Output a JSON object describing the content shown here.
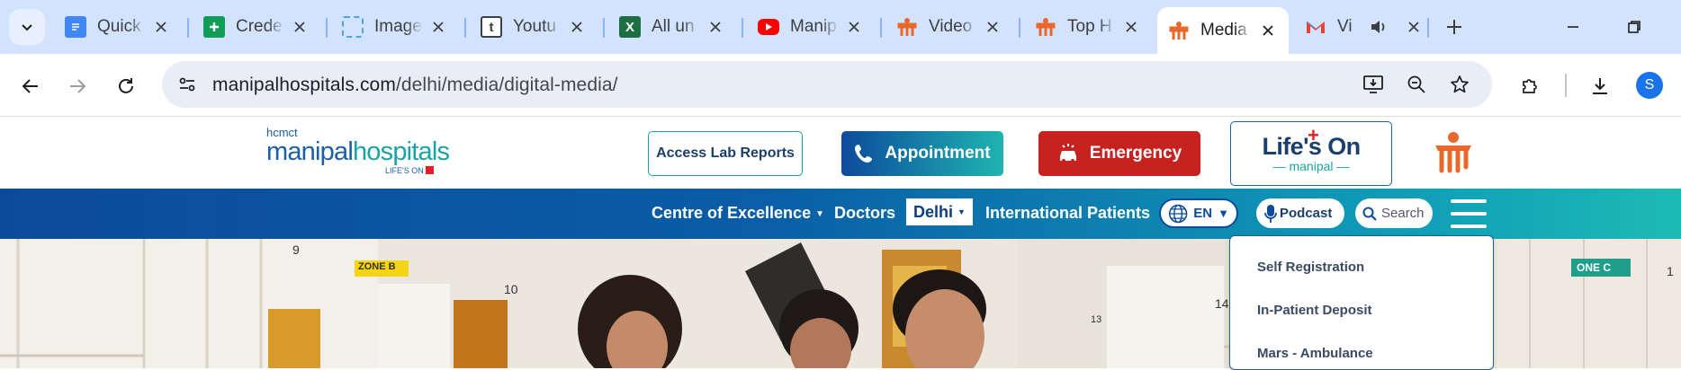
{
  "browser": {
    "tabs": [
      {
        "label": "Quick",
        "icon": "google-docs-icon",
        "color": "#4285f4"
      },
      {
        "label": "Crede",
        "icon": "google-sheets-icon",
        "color": "#0f9d58"
      },
      {
        "label": "Image",
        "icon": "image-icon",
        "color": "#4fa3e0"
      },
      {
        "label": "Youtu",
        "icon": "t-letter-icon",
        "color": "#3c4043"
      },
      {
        "label": "All un",
        "icon": "excel-icon",
        "color": "#1d6f42"
      },
      {
        "label": "Manip",
        "icon": "youtube-icon",
        "color": "#ff0000"
      },
      {
        "label": "Video",
        "icon": "manipal-icon",
        "color": "#e8672b"
      },
      {
        "label": "Top H",
        "icon": "manipal-icon",
        "color": "#e8672b"
      },
      {
        "label": "Media",
        "icon": "manipal-icon",
        "color": "#e8672b",
        "active": true
      },
      {
        "label": "Vi",
        "icon": "gmail-icon",
        "color": "#ea4335",
        "audio": true
      }
    ],
    "url_host": "manipalhospitals.com",
    "url_path": "/delhi/media/digital-media/",
    "profile_initial": "S"
  },
  "site": {
    "logo_small": "hcmct",
    "logo_main_a": "manipal",
    "logo_main_b": "hospitals",
    "logo_tag": "LIFE'S ON",
    "lab_reports": "Access Lab Reports",
    "appointment": "Appointment",
    "emergency": "Emergency",
    "lifes_on": "Life's On",
    "lifes_on_sub": "manipal",
    "nav": {
      "centre": "Centre of Excellence",
      "doctors": "Doctors",
      "city": "Delhi",
      "international": "International Patients",
      "lang": "EN",
      "podcast": "Podcast",
      "search": "Search"
    },
    "menu": [
      "Self Registration",
      "In-Patient Deposit",
      "Mars - Ambulance"
    ]
  },
  "hero": {
    "sign_left": "ZONE B",
    "sign_right": "ONE C",
    "bed_numbers": [
      "9",
      "10",
      "13",
      "14",
      "1"
    ]
  },
  "colors": {
    "brand_blue": "#1b5fa6",
    "teal": "#1aa3a3",
    "emergency_red": "#c7221f",
    "manipal_orange": "#e8672b"
  }
}
